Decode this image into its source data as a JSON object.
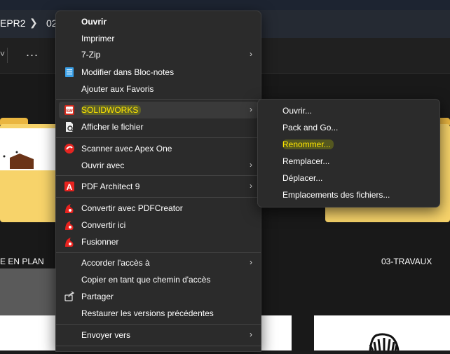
{
  "explorer": {
    "breadcrumb": [
      "EPR2",
      "02"
    ],
    "more_label": "...",
    "items": [
      {
        "label": "E EN PLAN"
      },
      {
        "label": "03-TRAVAUX"
      }
    ]
  },
  "context_menu": {
    "items": [
      {
        "id": "ouvrir",
        "label": "Ouvrir",
        "bold": true,
        "icon": "",
        "submenu": false
      },
      {
        "id": "imprimer",
        "label": "Imprimer",
        "icon": "",
        "submenu": false
      },
      {
        "id": "7zip",
        "label": "7-Zip",
        "icon": "",
        "submenu": true
      },
      {
        "id": "bloc-notes",
        "label": "Modifier dans Bloc-notes",
        "icon": "notepad-icon",
        "submenu": false
      },
      {
        "id": "favoris",
        "label": "Ajouter aux Favoris",
        "icon": "",
        "submenu": false
      },
      {
        "id": "solidworks",
        "label": "SOLIDWORKS",
        "icon": "solidworks-icon",
        "submenu": true,
        "highlighted": true
      },
      {
        "id": "afficher",
        "label": "Afficher le fichier",
        "icon": "file-view-icon",
        "submenu": false
      },
      {
        "id": "apex",
        "label": "Scanner avec Apex One",
        "icon": "apex-one-icon",
        "submenu": false
      },
      {
        "id": "ouvrir-avec",
        "label": "Ouvrir avec",
        "icon": "",
        "submenu": true
      },
      {
        "id": "pdf-architect",
        "label": "PDF Architect 9",
        "icon": "pdf-architect-icon",
        "submenu": true
      },
      {
        "id": "pdfcreator",
        "label": "Convertir avec PDFCreator",
        "icon": "pdfcreator-icon",
        "submenu": false
      },
      {
        "id": "convertir-ici",
        "label": "Convertir ici",
        "icon": "pdfcreator-icon",
        "submenu": false
      },
      {
        "id": "fusionner",
        "label": "Fusionner",
        "icon": "pdfcreator-icon",
        "submenu": false
      },
      {
        "id": "acces",
        "label": "Accorder l'accès à",
        "icon": "",
        "submenu": true
      },
      {
        "id": "copier-chemin",
        "label": "Copier en tant que chemin d'accès",
        "icon": "",
        "submenu": false
      },
      {
        "id": "partager",
        "label": "Partager",
        "icon": "share-icon",
        "submenu": false
      },
      {
        "id": "restaurer",
        "label": "Restaurer les versions précédentes",
        "icon": "",
        "submenu": false
      },
      {
        "id": "envoyer",
        "label": "Envoyer vers",
        "icon": "",
        "submenu": true
      }
    ]
  },
  "submenu": {
    "items": [
      {
        "label": "Ouvrir..."
      },
      {
        "label": "Pack and Go..."
      },
      {
        "label": "Renommer...",
        "highlighted": true
      },
      {
        "label": "Remplacer..."
      },
      {
        "label": "Déplacer..."
      },
      {
        "label": "Emplacements des fichiers..."
      }
    ]
  },
  "colors": {
    "menu_bg": "#2b2b2b",
    "highlight_text": "#ffe600",
    "folder_yellow": "#f7d36a",
    "pdf_red": "#e8231f"
  }
}
